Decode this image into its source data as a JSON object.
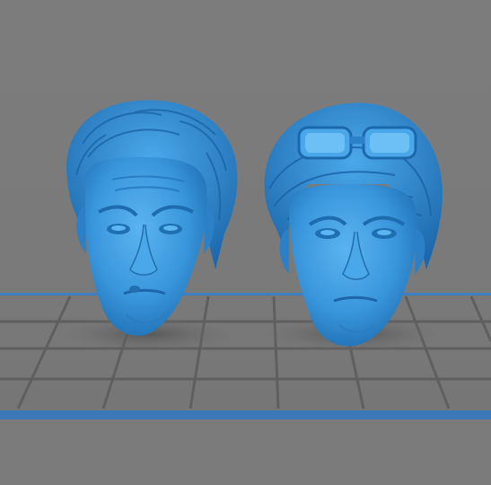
{
  "viewport": {
    "background_color": "#7a7a7a",
    "grid_color": "#5e5e5e",
    "plate_edge_color": "#3b78b8",
    "model_color": "#3e9be0"
  },
  "models": [
    {
      "name": "head-model-left"
    },
    {
      "name": "head-model-right-with-goggles"
    }
  ]
}
